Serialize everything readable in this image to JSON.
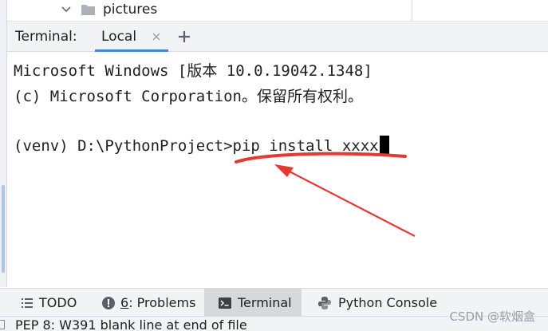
{
  "project_tree": {
    "folder_label": "pictures"
  },
  "terminal_panel": {
    "title": "Terminal:",
    "tabs": [
      {
        "label": "Local"
      }
    ],
    "lines": [
      "Microsoft Windows [版本 10.0.19042.1348]",
      "(c) Microsoft Corporation。保留所有权利。"
    ],
    "prompt": "(venv) D:\\PythonProject>",
    "command": "pip install xxxx"
  },
  "tool_windows": [
    {
      "label": "TODO",
      "icon": "list-icon"
    },
    {
      "mnemonic": "6",
      "label_rest": ": Problems",
      "icon": "warning-icon"
    },
    {
      "label": "Terminal",
      "icon": "terminal-icon",
      "active": true
    },
    {
      "label": "Python Console",
      "icon": "python-icon"
    }
  ],
  "status_bar": {
    "message": "PEP 8: W391 blank line at end of file"
  },
  "watermark": "CSDN @软烟盒",
  "colors": {
    "annotation_red": "#e53935",
    "tab_underline": "#4a86d8",
    "active_tool_window": "#d6d8dc"
  }
}
